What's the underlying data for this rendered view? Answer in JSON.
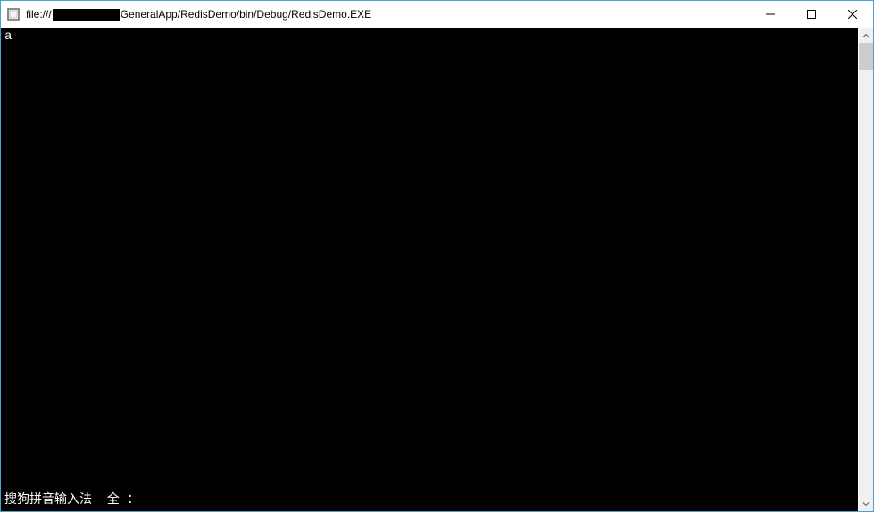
{
  "titlebar": {
    "title_prefix": "file:///",
    "title_suffix": "GeneralApp/RedisDemo/bin/Debug/RedisDemo.EXE"
  },
  "console": {
    "output": "a",
    "ime_status": "搜狗拼音输入法  全 ："
  },
  "window_controls": {
    "minimize": "Minimize",
    "maximize": "Maximize",
    "close": "Close"
  }
}
